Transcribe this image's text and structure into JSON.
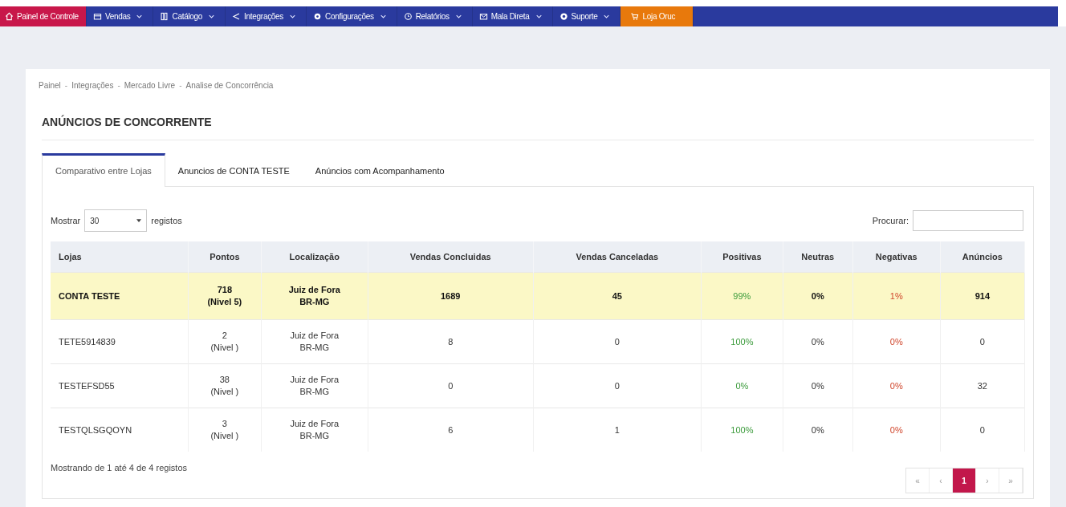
{
  "nav": [
    {
      "label": "Painel de Controle",
      "kind": "home",
      "has_menu": false
    },
    {
      "label": "Vendas",
      "kind": "normal",
      "has_menu": true
    },
    {
      "label": "Catálogo",
      "kind": "normal",
      "has_menu": true
    },
    {
      "label": "Integrações",
      "kind": "normal",
      "has_menu": true
    },
    {
      "label": "Configurações",
      "kind": "normal",
      "has_menu": true
    },
    {
      "label": "Relatórios",
      "kind": "normal",
      "has_menu": true
    },
    {
      "label": "Mala Direta",
      "kind": "normal",
      "has_menu": true
    },
    {
      "label": "Suporte",
      "kind": "normal",
      "has_menu": true
    },
    {
      "label": "Loja Oruc",
      "kind": "store",
      "has_menu": false
    }
  ],
  "breadcrumb": {
    "separator": "-",
    "items": [
      "Painel",
      "Integrações",
      "Mercado Livre",
      "Analise de Concorrência"
    ]
  },
  "card": {
    "title": "ANÚNCIOS DE CONCORRENTE",
    "tabs": [
      {
        "label": "Comparativo entre Lojas",
        "selected": true
      },
      {
        "label": "Anuncios de CONTA TESTE",
        "selected": false
      },
      {
        "label": "Anúncios com Acompanhamento",
        "selected": false
      }
    ],
    "length": {
      "before": "Mostrar",
      "value": "30",
      "after": "registos"
    },
    "search": {
      "label": "Procurar:"
    },
    "table": {
      "columns": [
        "Lojas",
        "Pontos",
        "Localização",
        "Vendas Concluidas",
        "Vendas Canceladas",
        "Positivas",
        "Neutras",
        "Negativas",
        "Anúncios"
      ],
      "rows": [
        {
          "highlighted": true,
          "cells": [
            "CONTA TESTE",
            "718\n(Nivel 5)",
            "Juiz de Fora\nBR-MG",
            "1689",
            "45",
            "99%",
            "0%",
            "1%",
            "914"
          ]
        },
        {
          "highlighted": false,
          "cells": [
            "TETE5914839",
            "2\n(Nivel )",
            "Juiz de Fora\nBR-MG",
            "8",
            "0",
            "100%",
            "0%",
            "0%",
            "0"
          ]
        },
        {
          "highlighted": false,
          "cells": [
            "TESTEFSD55",
            "38\n(Nivel )",
            "Juiz de Fora\nBR-MG",
            "0",
            "0",
            "0%",
            "0%",
            "0%",
            "32"
          ]
        },
        {
          "highlighted": false,
          "cells": [
            "TESTQLSGQOYN",
            "3\n(Nivel )",
            "Juiz de Fora\nBR-MG",
            "6",
            "1",
            "100%",
            "0%",
            "0%",
            "0"
          ]
        }
      ]
    },
    "info": "Mostrando de 1 até 4 de 4 registos",
    "pagination": [
      {
        "label": "«",
        "selected": false
      },
      {
        "label": "‹",
        "selected": false
      },
      {
        "label": "1",
        "selected": true
      },
      {
        "label": "›",
        "selected": false
      },
      {
        "label": "»",
        "selected": false
      }
    ]
  }
}
